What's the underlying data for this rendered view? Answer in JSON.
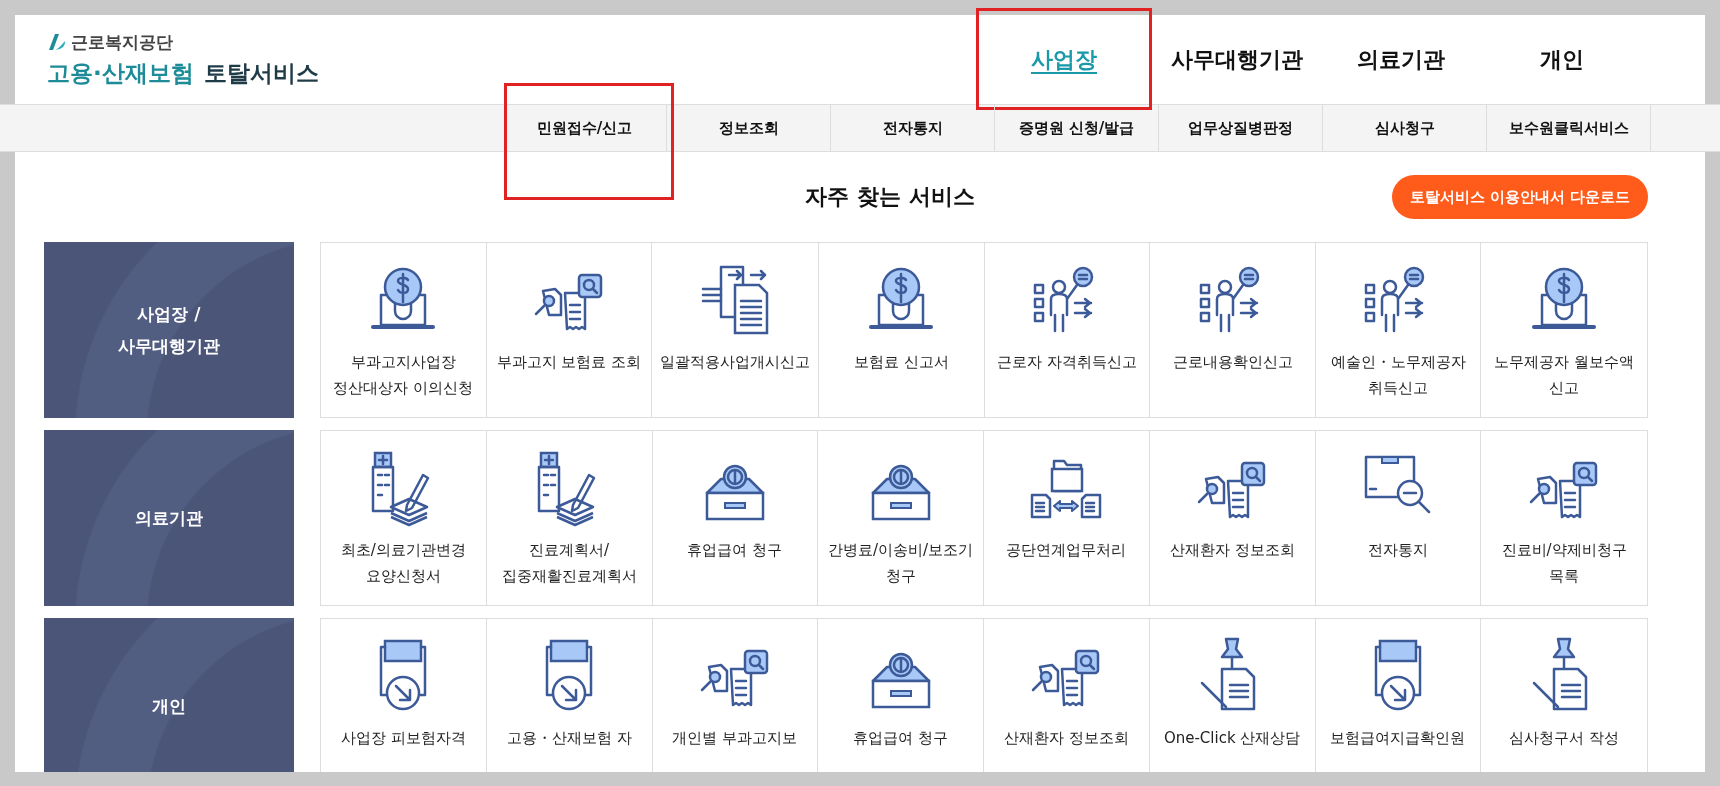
{
  "logo": {
    "org": "근로복지공단",
    "title_main": "고용·산재보험",
    "title_sub": "토탈서비스"
  },
  "top_nav": [
    {
      "label": "사업장",
      "selected": true,
      "highlighted": true
    },
    {
      "label": "사무대행기관",
      "selected": false,
      "highlighted": false
    },
    {
      "label": "의료기관",
      "selected": false,
      "highlighted": false
    },
    {
      "label": "개인",
      "selected": false,
      "highlighted": false
    }
  ],
  "menu": [
    {
      "label": "민원접수/신고",
      "highlighted": true
    },
    {
      "label": "정보조회",
      "highlighted": false
    },
    {
      "label": "전자통지",
      "highlighted": false
    },
    {
      "label": "증명원 신청/발급",
      "highlighted": false
    },
    {
      "label": "업무상질병판정",
      "highlighted": false
    },
    {
      "label": "심사청구",
      "highlighted": false
    },
    {
      "label": "보수원클릭서비스",
      "highlighted": false
    }
  ],
  "section_title": "자주 찾는 서비스",
  "download_button": "토탈서비스 이용안내서 다운로드",
  "groups": [
    {
      "title": "사업장 /\n사무대행기관",
      "services": [
        {
          "label": "부과고지사업장 정산대상자 이의신청",
          "kind": "bulb-laptop"
        },
        {
          "label": "부과고지 보험료 조회",
          "kind": "doc-search"
        },
        {
          "label": "일괄적용사업개시신고",
          "kind": "doc-transfer"
        },
        {
          "label": "보험료 신고서",
          "kind": "bulb-laptop"
        },
        {
          "label": "근로자 자격취득신고",
          "kind": "presenter"
        },
        {
          "label": "근로내용확인신고",
          "kind": "presenter"
        },
        {
          "label": "예술인・노무제공자 취득신고",
          "kind": "presenter"
        },
        {
          "label": "노무제공자 월보수액 신고",
          "kind": "bulb-laptop"
        }
      ]
    },
    {
      "title": "의료기관",
      "services": [
        {
          "label": "최초/의료기관변경 요양신청서",
          "kind": "hospital-pen"
        },
        {
          "label": "진료계획서/집중재활진료계획서",
          "kind": "hospital-pen"
        },
        {
          "label": "휴업급여 청구",
          "kind": "coin-box"
        },
        {
          "label": "간병료/이송비/보조기 청구",
          "kind": "coin-box"
        },
        {
          "label": "공단연계업무처리",
          "kind": "folder-exchange"
        },
        {
          "label": "산재환자 정보조회",
          "kind": "doc-search"
        },
        {
          "label": "전자통지",
          "kind": "box-search"
        },
        {
          "label": "진료비/약제비청구 목록",
          "kind": "doc-search"
        }
      ]
    },
    {
      "title": "개인",
      "services": [
        {
          "label": "사업장 피보험자격",
          "kind": "tray-arrow"
        },
        {
          "label": "고용・산재보험 자",
          "kind": "tray-arrow"
        },
        {
          "label": "개인별 부과고지보",
          "kind": "doc-search"
        },
        {
          "label": "휴업급여 청구",
          "kind": "coin-box"
        },
        {
          "label": "산재환자 정보조회",
          "kind": "doc-search"
        },
        {
          "label": "One-Click 산재상담",
          "kind": "pin-doc"
        },
        {
          "label": "보험급여지급확인원",
          "kind": "tray-arrow"
        },
        {
          "label": "심사청구서 작성",
          "kind": "pin-doc"
        }
      ]
    }
  ]
}
